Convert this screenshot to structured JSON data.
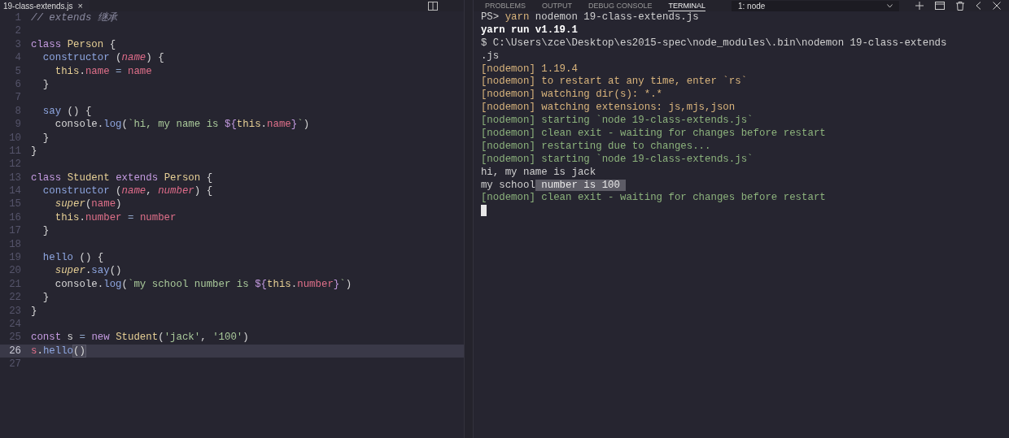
{
  "editor": {
    "tab": {
      "label": "19-class-extends.js",
      "close": "×"
    },
    "lines": [
      {
        "number": "1",
        "current": false,
        "tokens": [
          {
            "kind": "comment",
            "text": "// extends 继承"
          }
        ]
      },
      {
        "number": "2",
        "current": false
      },
      {
        "number": "3",
        "current": false,
        "tokens": [
          {
            "kind": "keyword",
            "text": "class "
          },
          {
            "kind": "class",
            "text": "Person"
          },
          {
            "kind": "plain",
            "text": " {"
          }
        ]
      },
      {
        "number": "4",
        "current": false,
        "tokens": [
          {
            "kind": "func",
            "text": "  constructor"
          },
          {
            "kind": "plain",
            "text": " ("
          },
          {
            "kind": "param",
            "text": "name"
          },
          {
            "kind": "plain",
            "text": ") {"
          }
        ]
      },
      {
        "number": "5",
        "current": false,
        "tokens": [
          {
            "kind": "this",
            "text": "    this"
          },
          {
            "kind": "plain",
            "text": "."
          },
          {
            "kind": "prop",
            "text": "name"
          },
          {
            "kind": "op",
            "text": " = "
          },
          {
            "kind": "prop",
            "text": "name"
          }
        ]
      },
      {
        "number": "6",
        "current": false,
        "tokens": [
          {
            "kind": "plain",
            "text": "  }"
          }
        ]
      },
      {
        "number": "7",
        "current": false
      },
      {
        "number": "8",
        "current": false,
        "tokens": [
          {
            "kind": "func",
            "text": "  say"
          },
          {
            "kind": "plain",
            "text": " () {"
          }
        ]
      },
      {
        "number": "9",
        "current": false,
        "tokens": [
          {
            "kind": "plain",
            "text": "    console."
          },
          {
            "kind": "func",
            "text": "log"
          },
          {
            "kind": "plain",
            "text": "("
          },
          {
            "kind": "string",
            "text": "`hi, my name is "
          },
          {
            "kind": "interp",
            "text": "${"
          },
          {
            "kind": "this",
            "text": "this"
          },
          {
            "kind": "plain",
            "text": "."
          },
          {
            "kind": "prop",
            "text": "name"
          },
          {
            "kind": "interp",
            "text": "}"
          },
          {
            "kind": "string",
            "text": "`"
          },
          {
            "kind": "plain",
            "text": ")"
          }
        ]
      },
      {
        "number": "10",
        "current": false,
        "tokens": [
          {
            "kind": "plain",
            "text": "  }"
          }
        ]
      },
      {
        "number": "11",
        "current": false,
        "tokens": [
          {
            "kind": "plain",
            "text": "}"
          }
        ]
      },
      {
        "number": "12",
        "current": false
      },
      {
        "number": "13",
        "current": false,
        "tokens": [
          {
            "kind": "keyword",
            "text": "class "
          },
          {
            "kind": "class",
            "text": "Student "
          },
          {
            "kind": "keyword",
            "text": "extends "
          },
          {
            "kind": "class",
            "text": "Person"
          },
          {
            "kind": "plain",
            "text": " {"
          }
        ]
      },
      {
        "number": "14",
        "current": false,
        "tokens": [
          {
            "kind": "func",
            "text": "  constructor"
          },
          {
            "kind": "plain",
            "text": " ("
          },
          {
            "kind": "param",
            "text": "name"
          },
          {
            "kind": "plain",
            "text": ", "
          },
          {
            "kind": "param",
            "text": "number"
          },
          {
            "kind": "plain",
            "text": ") {"
          }
        ]
      },
      {
        "number": "15",
        "current": false,
        "tokens": [
          {
            "kind": "super",
            "text": "    super"
          },
          {
            "kind": "plain",
            "text": "("
          },
          {
            "kind": "prop",
            "text": "name"
          },
          {
            "kind": "plain",
            "text": ")"
          }
        ]
      },
      {
        "number": "16",
        "current": false,
        "tokens": [
          {
            "kind": "this",
            "text": "    this"
          },
          {
            "kind": "plain",
            "text": "."
          },
          {
            "kind": "prop",
            "text": "number"
          },
          {
            "kind": "op",
            "text": " = "
          },
          {
            "kind": "prop",
            "text": "number"
          }
        ]
      },
      {
        "number": "17",
        "current": false,
        "tokens": [
          {
            "kind": "plain",
            "text": "  }"
          }
        ]
      },
      {
        "number": "18",
        "current": false
      },
      {
        "number": "19",
        "current": false,
        "tokens": [
          {
            "kind": "func",
            "text": "  hello"
          },
          {
            "kind": "plain",
            "text": " () {"
          }
        ]
      },
      {
        "number": "20",
        "current": false,
        "tokens": [
          {
            "kind": "super",
            "text": "    super"
          },
          {
            "kind": "plain",
            "text": "."
          },
          {
            "kind": "func",
            "text": "say"
          },
          {
            "kind": "plain",
            "text": "()"
          }
        ]
      },
      {
        "number": "21",
        "current": false,
        "tokens": [
          {
            "kind": "plain",
            "text": "    console."
          },
          {
            "kind": "func",
            "text": "log"
          },
          {
            "kind": "plain",
            "text": "("
          },
          {
            "kind": "string",
            "text": "`my school number is "
          },
          {
            "kind": "interp",
            "text": "${"
          },
          {
            "kind": "this",
            "text": "this"
          },
          {
            "kind": "plain",
            "text": "."
          },
          {
            "kind": "prop",
            "text": "number"
          },
          {
            "kind": "interp",
            "text": "}"
          },
          {
            "kind": "string",
            "text": "`"
          },
          {
            "kind": "plain",
            "text": ")"
          }
        ]
      },
      {
        "number": "22",
        "current": false,
        "tokens": [
          {
            "kind": "plain",
            "text": "  }"
          }
        ]
      },
      {
        "number": "23",
        "current": false,
        "tokens": [
          {
            "kind": "plain",
            "text": "}"
          }
        ]
      },
      {
        "number": "24",
        "current": false
      },
      {
        "number": "25",
        "current": false,
        "tokens": [
          {
            "kind": "keyword",
            "text": "const"
          },
          {
            "kind": "plain",
            "text": " s "
          },
          {
            "kind": "op",
            "text": "= "
          },
          {
            "kind": "keyword",
            "text": "new "
          },
          {
            "kind": "class",
            "text": "Student"
          },
          {
            "kind": "plain",
            "text": "("
          },
          {
            "kind": "string",
            "text": "'jack'"
          },
          {
            "kind": "plain",
            "text": ", "
          },
          {
            "kind": "string",
            "text": "'100'"
          },
          {
            "kind": "plain",
            "text": ")"
          }
        ]
      },
      {
        "number": "26",
        "current": true,
        "tokens": [
          {
            "kind": "prop",
            "text": "s"
          },
          {
            "kind": "plain",
            "text": "."
          },
          {
            "kind": "func",
            "text": "hello"
          },
          {
            "kind": "match",
            "text": "()"
          }
        ]
      },
      {
        "number": "27",
        "current": false
      }
    ]
  },
  "panel": {
    "tabs": [
      {
        "label": "PROBLEMS",
        "selected": false
      },
      {
        "label": "OUTPUT",
        "selected": false
      },
      {
        "label": "DEBUG CONSOLE",
        "selected": false
      },
      {
        "label": "TERMINAL",
        "selected": true
      }
    ],
    "terminal_select": "1: node"
  },
  "terminal": {
    "cursor": true,
    "lines": [
      [
        {
          "kind": "plain",
          "text": "PS> "
        },
        {
          "kind": "yellow",
          "text": "yarn"
        },
        {
          "kind": "plain",
          "text": " nodemon 19-class-extends.js"
        }
      ],
      [
        {
          "kind": "bold",
          "text": "yarn run v1.19.1"
        }
      ],
      [
        {
          "kind": "plain",
          "text": "$ C:\\Users\\zce\\Desktop\\es2015-spec\\node_modules\\.bin\\nodemon 19-class-extends"
        }
      ],
      [
        {
          "kind": "plain",
          "text": ".js"
        }
      ],
      [
        {
          "kind": "yellow",
          "text": "[nodemon] 1.19.4"
        }
      ],
      [
        {
          "kind": "yellow",
          "text": "[nodemon] to restart at any time, enter `rs`"
        }
      ],
      [
        {
          "kind": "yellow",
          "text": "[nodemon] watching dir(s): *.*"
        }
      ],
      [
        {
          "kind": "yellow",
          "text": "[nodemon] watching extensions: js,mjs,json"
        }
      ],
      [
        {
          "kind": "green",
          "text": "[nodemon] starting `node 19-class-extends.js`"
        }
      ],
      [
        {
          "kind": "green",
          "text": "[nodemon] clean exit - waiting for changes before restart"
        }
      ],
      [
        {
          "kind": "green",
          "text": "[nodemon] restarting due to changes..."
        }
      ],
      [
        {
          "kind": "green",
          "text": "[nodemon] starting `node 19-class-extends.js`"
        }
      ],
      [
        {
          "kind": "plain",
          "text": "hi, my name is jack"
        }
      ],
      [
        {
          "kind": "plain",
          "text": "my school"
        },
        {
          "kind": "selected",
          "text": " number is 100 "
        }
      ],
      [
        {
          "kind": "green",
          "text": "[nodemon] clean exit - waiting for changes before restart"
        }
      ]
    ]
  }
}
